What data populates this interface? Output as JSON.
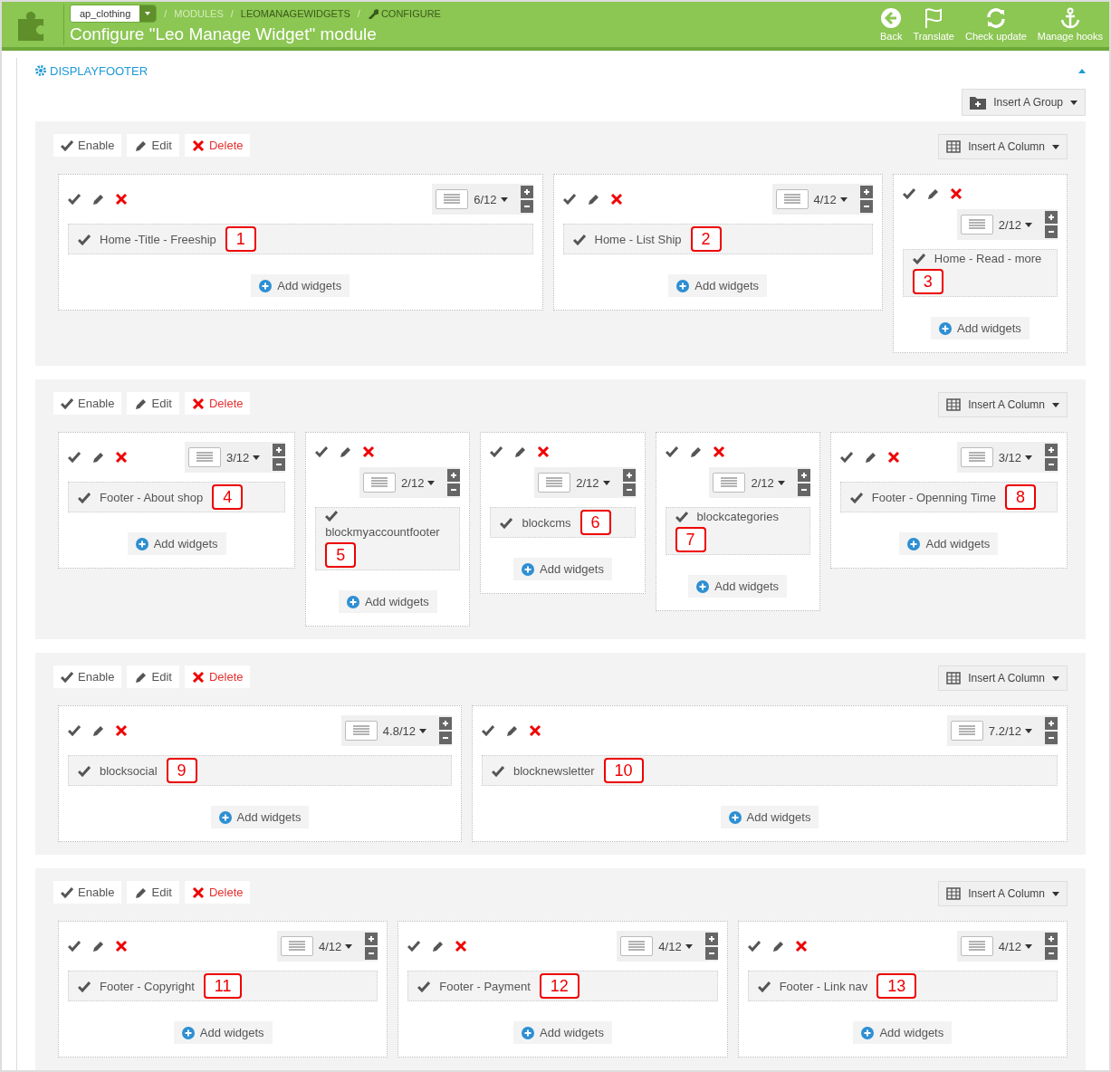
{
  "header": {
    "shop_select": "ap_clothing",
    "breadcrumb": [
      {
        "separator": "/",
        "label": "MODULES"
      },
      {
        "separator": "/",
        "label": "LEOMANAGEWIDGETS"
      },
      {
        "separator": "/",
        "label": "CONFIGURE"
      }
    ],
    "title": "Configure \"Leo Manage Widget\" module",
    "toolbar": [
      {
        "label": "Back"
      },
      {
        "label": "Translate"
      },
      {
        "label": "Check update"
      },
      {
        "label": "Manage hooks"
      }
    ]
  },
  "panel": {
    "title": "DISPLAYFOOTER",
    "insert_group": "Insert A Group",
    "groups": [
      {
        "actions": [
          "Enable",
          "Edit",
          "Delete"
        ],
        "insert_column": "Insert A Column",
        "columns": [
          {
            "width": "6/12",
            "widgets": [
              {
                "name": "Home -Title - Freeship",
                "callout": "1"
              }
            ],
            "add": "Add widgets"
          },
          {
            "width": "4/12",
            "widgets": [
              {
                "name": "Home - List Ship",
                "callout": "2"
              }
            ],
            "add": "Add widgets"
          },
          {
            "width": "2/12",
            "widgets": [
              {
                "name": "Home - Read - more",
                "callout": "3"
              }
            ],
            "add": "Add widgets"
          }
        ]
      },
      {
        "actions": [
          "Enable",
          "Edit",
          "Delete"
        ],
        "insert_column": "Insert A Column",
        "columns": [
          {
            "width": "3/12",
            "widgets": [
              {
                "name": "Footer - About shop",
                "callout": "4"
              }
            ],
            "add": "Add widgets"
          },
          {
            "width": "2/12",
            "widgets": [
              {
                "name": "blockmyaccountfooter",
                "callout": "5"
              }
            ],
            "add": "Add widgets"
          },
          {
            "width": "2/12",
            "widgets": [
              {
                "name": "blockcms",
                "callout": "6"
              }
            ],
            "add": "Add widgets"
          },
          {
            "width": "2/12",
            "widgets": [
              {
                "name": "blockcategories",
                "callout": "7"
              }
            ],
            "add": "Add widgets"
          },
          {
            "width": "3/12",
            "widgets": [
              {
                "name": "Footer - Openning Time",
                "callout": "8"
              }
            ],
            "add": "Add widgets"
          }
        ]
      },
      {
        "actions": [
          "Enable",
          "Edit",
          "Delete"
        ],
        "insert_column": "Insert A Column",
        "columns": [
          {
            "width": "4.8/12",
            "widgets": [
              {
                "name": "blocksocial",
                "callout": "9"
              }
            ],
            "add": "Add widgets"
          },
          {
            "width": "7.2/12",
            "widgets": [
              {
                "name": "blocknewsletter",
                "callout": "10"
              }
            ],
            "add": "Add widgets"
          }
        ]
      },
      {
        "actions": [
          "Enable",
          "Edit",
          "Delete"
        ],
        "insert_column": "Insert A Column",
        "columns": [
          {
            "width": "4/12",
            "widgets": [
              {
                "name": "Footer - Copyright",
                "callout": "11"
              }
            ],
            "add": "Add widgets"
          },
          {
            "width": "4/12",
            "widgets": [
              {
                "name": "Footer - Payment",
                "callout": "12"
              }
            ],
            "add": "Add widgets"
          },
          {
            "width": "4/12",
            "widgets": [
              {
                "name": "Footer - Link nav",
                "callout": "13"
              }
            ],
            "add": "Add widgets"
          }
        ]
      }
    ]
  }
}
